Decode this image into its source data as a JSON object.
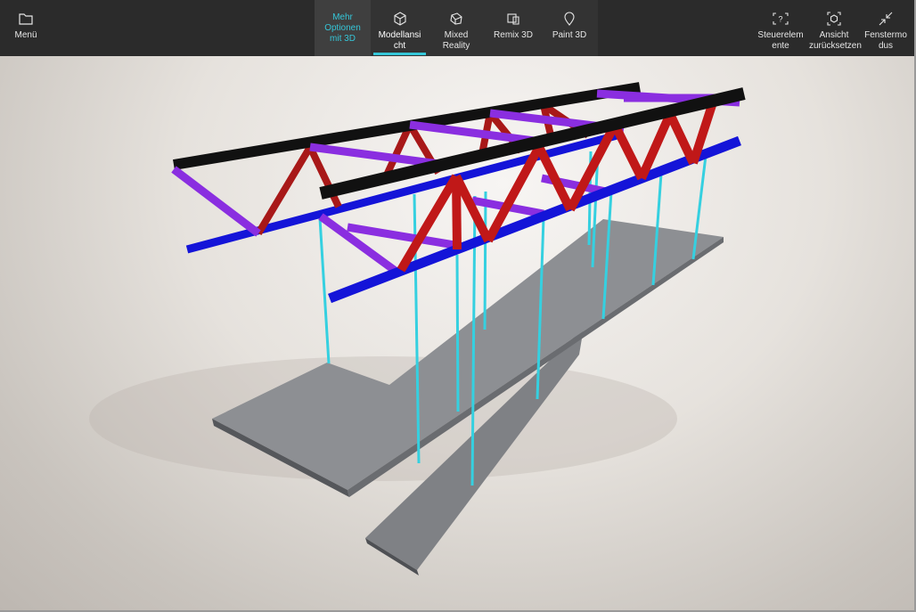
{
  "toolbar": {
    "menu_label": "Menü",
    "more_options_label": "Mehr Optionen mit 3D",
    "tabs": [
      {
        "label": "Modellansicht",
        "icon": "cube-icon",
        "active": true
      },
      {
        "label": "Mixed Reality",
        "icon": "mixed-reality-icon",
        "active": false
      },
      {
        "label": "Remix 3D",
        "icon": "remix-3d-icon",
        "active": false
      },
      {
        "label": "Paint 3D",
        "icon": "paint-3d-icon",
        "active": false
      }
    ],
    "right": [
      {
        "label": "Steuerelemente",
        "icon": "controls-icon"
      },
      {
        "label": "Ansicht zurücksetzen",
        "icon": "reset-view-icon"
      },
      {
        "label": "Fenstermodus",
        "icon": "window-mode-icon"
      }
    ]
  },
  "colors": {
    "toolbar_bg": "#2b2b2b",
    "accent": "#35c6d8",
    "top_chord": "#111111",
    "bottom_chord": "#1414d8",
    "diagonal": "#c01818",
    "cross_beam": "#8a2ee0",
    "hanger": "#35d0e0",
    "deck": "#8a8a8a"
  }
}
